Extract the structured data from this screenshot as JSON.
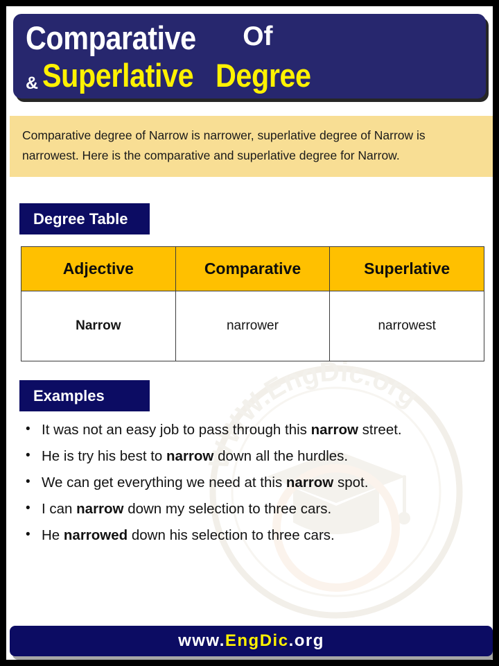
{
  "header": {
    "title_part1": "Comparative",
    "title_of": "Of",
    "title_amp": "&",
    "title_part2": "Superlative",
    "title_part3": "Degree",
    "word": "Narrow",
    "banner_color": "#27276e",
    "accent_yellow": "#fff200"
  },
  "intro": {
    "text": "Comparative degree of Narrow is narrower, superlative degree of Narrow is narrowest. Here is the comparative and superlative degree for Narrow.",
    "background_color": "#f8de94"
  },
  "degree_section": {
    "label": "Degree Table",
    "label_color": "#0c0c63",
    "header_color": "#ffc000",
    "columns": [
      "Adjective",
      "Comparative",
      "Superlative"
    ],
    "rows": [
      {
        "adjective": "Narrow",
        "comparative": "narrower",
        "superlative": "narrowest"
      }
    ]
  },
  "examples_section": {
    "label": "Examples",
    "items": [
      {
        "before": "It was not an easy job to pass through this ",
        "bold": "narrow",
        "after": " street."
      },
      {
        "before": "He is try his best to ",
        "bold": "narrow",
        "after": " down all the hurdles."
      },
      {
        "before": "We can get everything we need at this ",
        "bold": "narrow",
        "after": " spot."
      },
      {
        "before": "I can ",
        "bold": "narrow",
        "after": " down my selection to three cars."
      },
      {
        "before": "He ",
        "bold": "narrowed",
        "after": " down his selection to three cars."
      }
    ]
  },
  "footer": {
    "prefix": "www.",
    "brand": "EngDic",
    "suffix": ".org"
  },
  "watermark": {
    "text": "WWW.EngDic.org",
    "icon": "graduation-cap-icon"
  }
}
